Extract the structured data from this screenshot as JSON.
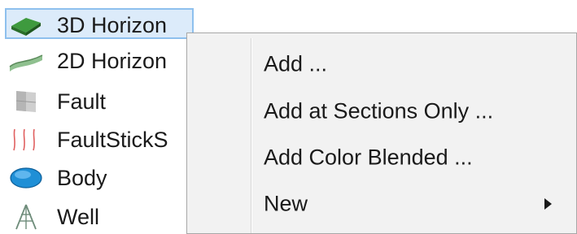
{
  "tree": {
    "items": [
      {
        "label": "3D Horizon",
        "icon": "horizon-3d-icon",
        "selected": true
      },
      {
        "label": "2D Horizon",
        "icon": "horizon-2d-icon",
        "selected": false
      },
      {
        "label": "Fault",
        "icon": "fault-icon",
        "selected": false
      },
      {
        "label": "FaultStickS",
        "icon": "fault-stick-set-icon",
        "selected": false
      },
      {
        "label": "Body",
        "icon": "body-icon",
        "selected": false
      },
      {
        "label": "Well",
        "icon": "well-icon",
        "selected": false
      }
    ]
  },
  "context_menu": {
    "items": [
      {
        "label": "Add ...",
        "has_submenu": false
      },
      {
        "label": "Add at Sections Only ...",
        "has_submenu": false
      },
      {
        "label": "Add Color Blended ...",
        "has_submenu": false
      },
      {
        "label": "New",
        "has_submenu": true
      }
    ]
  },
  "colors": {
    "selection_fill": "#dcebfa",
    "selection_border": "#8ec0ee",
    "menu_background": "#f2f2f2",
    "menu_border": "#a8a8a8",
    "horizon_3d_green": "#3e9a3e",
    "body_blue": "#1f8fd6"
  }
}
